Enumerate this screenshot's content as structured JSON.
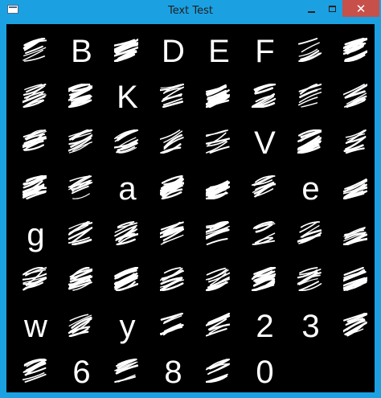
{
  "window": {
    "title": "Text Test",
    "close_glyph": "✕",
    "accent_color": "#1ba1e2",
    "close_color": "#c7504a"
  },
  "glyph_rows": [
    [
      "",
      "B",
      "",
      "D",
      "E",
      "F",
      "",
      ""
    ],
    [
      "",
      "",
      "K",
      "",
      "",
      "",
      "",
      ""
    ],
    [
      "",
      "",
      "",
      "",
      "",
      "V",
      "",
      ""
    ],
    [
      "",
      "",
      "a",
      "",
      "",
      "",
      "e",
      ""
    ],
    [
      "g",
      "",
      "",
      "",
      "",
      "",
      "",
      ""
    ],
    [
      "",
      "",
      "",
      "",
      "",
      "",
      "",
      ""
    ],
    [
      "w",
      "",
      "y",
      "",
      "",
      "2",
      "3",
      ""
    ],
    [
      "",
      "6",
      "",
      "8",
      "",
      "0"
    ]
  ]
}
